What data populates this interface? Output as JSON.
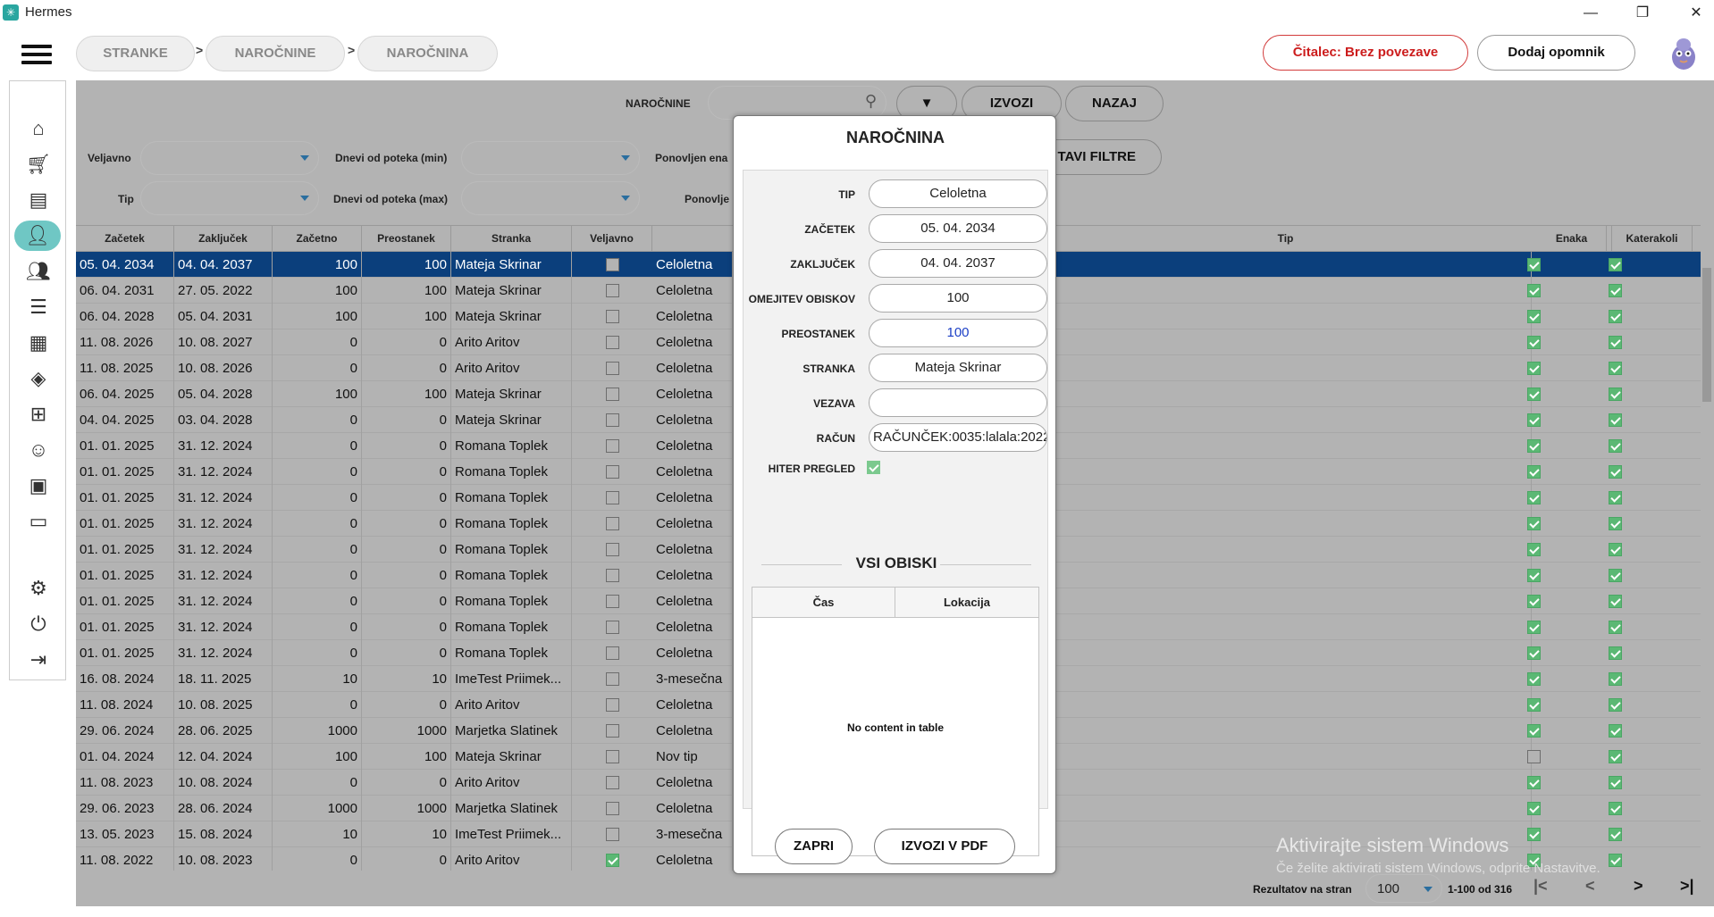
{
  "window": {
    "title": "Hermes",
    "minimize": "—",
    "restore": "❐",
    "close": "✕"
  },
  "breadcrumb": [
    {
      "label": "STRANKE"
    },
    {
      "label": "NAROČNINE"
    },
    {
      "label": "NAROČNINA"
    }
  ],
  "breadcrumb_sep": ">",
  "header": {
    "reader_label": "Čitalec: Brez povezave",
    "reminder_label": "Dodaj opomnik"
  },
  "sidebar": {
    "icons": [
      "home-icon",
      "cart-icon",
      "document-icon",
      "person-icon",
      "group-icon",
      "list-icon",
      "calendar-icon",
      "layers-icon",
      "network-icon",
      "worker-icon",
      "briefcase-icon",
      "chat-icon",
      "gear-icon",
      "power-icon",
      "logout-icon"
    ],
    "active": "person-icon"
  },
  "filters": {
    "search_label": "NAROČNINE",
    "search_value": "",
    "export_label": "IZVOZI",
    "back_label": "NAZAJ",
    "reset_label": "TAVI FILTRE",
    "valid_label": "Veljavno",
    "type_label": "Tip",
    "days_min_label": "Dnevi od poteka (min)",
    "days_max_label": "Dnevi od poteka (max)",
    "repeated_label": "Ponovljen ena",
    "repeated2_label": "Ponovlje"
  },
  "table": {
    "headers": {
      "start": "Začetek",
      "end": "Zaključek",
      "initial": "Začetno",
      "remaining": "Preostanek",
      "client": "Stranka",
      "valid": "Veljavno",
      "type": "Tip",
      "same": "Enaka",
      "any": "Katerakoli"
    },
    "rows": [
      {
        "start": "05. 04. 2034",
        "end": "04. 04. 2037",
        "initial": "100",
        "remaining": "100",
        "client": "Mateja Skrinar",
        "valid": false,
        "type": "Celoletna",
        "same": true,
        "any": true
      },
      {
        "start": "06. 04. 2031",
        "end": "27. 05. 2022",
        "initial": "100",
        "remaining": "100",
        "client": "Mateja Skrinar",
        "valid": false,
        "type": "Celoletna",
        "same": true,
        "any": true
      },
      {
        "start": "06. 04. 2028",
        "end": "05. 04. 2031",
        "initial": "100",
        "remaining": "100",
        "client": "Mateja Skrinar",
        "valid": false,
        "type": "Celoletna",
        "same": true,
        "any": true
      },
      {
        "start": "11. 08. 2026",
        "end": "10. 08. 2027",
        "initial": "0",
        "remaining": "0",
        "client": "Arito Aritov",
        "valid": false,
        "type": "Celoletna",
        "same": true,
        "any": true
      },
      {
        "start": "11. 08. 2025",
        "end": "10. 08. 2026",
        "initial": "0",
        "remaining": "0",
        "client": "Arito Aritov",
        "valid": false,
        "type": "Celoletna",
        "same": true,
        "any": true
      },
      {
        "start": "06. 04. 2025",
        "end": "05. 04. 2028",
        "initial": "100",
        "remaining": "100",
        "client": "Mateja Skrinar",
        "valid": false,
        "type": "Celoletna",
        "same": true,
        "any": true
      },
      {
        "start": "04. 04. 2025",
        "end": "03. 04. 2028",
        "initial": "0",
        "remaining": "0",
        "client": "Mateja Skrinar",
        "valid": false,
        "type": "Celoletna",
        "same": true,
        "any": true
      },
      {
        "start": "01. 01. 2025",
        "end": "31. 12. 2024",
        "initial": "0",
        "remaining": "0",
        "client": "Romana Toplek",
        "valid": false,
        "type": "Celoletna",
        "same": true,
        "any": true
      },
      {
        "start": "01. 01. 2025",
        "end": "31. 12. 2024",
        "initial": "0",
        "remaining": "0",
        "client": "Romana Toplek",
        "valid": false,
        "type": "Celoletna",
        "same": true,
        "any": true
      },
      {
        "start": "01. 01. 2025",
        "end": "31. 12. 2024",
        "initial": "0",
        "remaining": "0",
        "client": "Romana Toplek",
        "valid": false,
        "type": "Celoletna",
        "same": true,
        "any": true
      },
      {
        "start": "01. 01. 2025",
        "end": "31. 12. 2024",
        "initial": "0",
        "remaining": "0",
        "client": "Romana Toplek",
        "valid": false,
        "type": "Celoletna",
        "same": true,
        "any": true
      },
      {
        "start": "01. 01. 2025",
        "end": "31. 12. 2024",
        "initial": "0",
        "remaining": "0",
        "client": "Romana Toplek",
        "valid": false,
        "type": "Celoletna",
        "same": true,
        "any": true
      },
      {
        "start": "01. 01. 2025",
        "end": "31. 12. 2024",
        "initial": "0",
        "remaining": "0",
        "client": "Romana Toplek",
        "valid": false,
        "type": "Celoletna",
        "same": true,
        "any": true
      },
      {
        "start": "01. 01. 2025",
        "end": "31. 12. 2024",
        "initial": "0",
        "remaining": "0",
        "client": "Romana Toplek",
        "valid": false,
        "type": "Celoletna",
        "same": true,
        "any": true
      },
      {
        "start": "01. 01. 2025",
        "end": "31. 12. 2024",
        "initial": "0",
        "remaining": "0",
        "client": "Romana Toplek",
        "valid": false,
        "type": "Celoletna",
        "same": true,
        "any": true
      },
      {
        "start": "01. 01. 2025",
        "end": "31. 12. 2024",
        "initial": "0",
        "remaining": "0",
        "client": "Romana Toplek",
        "valid": false,
        "type": "Celoletna",
        "same": true,
        "any": true
      },
      {
        "start": "16. 08. 2024",
        "end": "18. 11. 2025",
        "initial": "10",
        "remaining": "10",
        "client": "ImeTest Priimek...",
        "valid": false,
        "type": "3-mesečna",
        "same": true,
        "any": true
      },
      {
        "start": "11. 08. 2024",
        "end": "10. 08. 2025",
        "initial": "0",
        "remaining": "0",
        "client": "Arito Aritov",
        "valid": false,
        "type": "Celoletna",
        "same": true,
        "any": true
      },
      {
        "start": "29. 06. 2024",
        "end": "28. 06. 2025",
        "initial": "1000",
        "remaining": "1000",
        "client": "Marjetka Slatinek",
        "valid": false,
        "type": "Celoletna",
        "same": true,
        "any": true
      },
      {
        "start": "01. 04. 2024",
        "end": "12. 04. 2024",
        "initial": "100",
        "remaining": "100",
        "client": "Mateja Skrinar",
        "valid": false,
        "type": "Nov tip",
        "same": false,
        "any": true
      },
      {
        "start": "11. 08. 2023",
        "end": "10. 08. 2024",
        "initial": "0",
        "remaining": "0",
        "client": "Arito Aritov",
        "valid": false,
        "type": "Celoletna",
        "same": true,
        "any": true
      },
      {
        "start": "29. 06. 2023",
        "end": "28. 06. 2024",
        "initial": "1000",
        "remaining": "1000",
        "client": "Marjetka Slatinek",
        "valid": false,
        "type": "Celoletna",
        "same": true,
        "any": true
      },
      {
        "start": "13. 05. 2023",
        "end": "15. 08. 2024",
        "initial": "10",
        "remaining": "10",
        "client": "ImeTest Priimek...",
        "valid": false,
        "type": "3-mesečna",
        "same": true,
        "any": true
      },
      {
        "start": "11. 08. 2022",
        "end": "10. 08. 2023",
        "initial": "0",
        "remaining": "0",
        "client": "Arito Aritov",
        "valid": true,
        "type": "Celoletna",
        "same": true,
        "any": true
      }
    ]
  },
  "footer": {
    "per_page_label": "Rezultatov na stran",
    "per_page_value": "100",
    "range": "1-100 od 316",
    "first": "|<",
    "prev": "<",
    "next": ">",
    "last": ">|"
  },
  "modal": {
    "title": "NAROČNINA",
    "fields": [
      {
        "label": "TIP",
        "value": "Celoletna"
      },
      {
        "label": "ZAČETEK",
        "value": "05. 04. 2034"
      },
      {
        "label": "ZAKLJUČEK",
        "value": "04. 04. 2037"
      },
      {
        "label": "OMEJITEV OBISKOV",
        "value": "100"
      },
      {
        "label": "PREOSTANEK",
        "value": "100"
      },
      {
        "label": "STRANKA",
        "value": "Mateja Skrinar"
      },
      {
        "label": "VEZAVA",
        "value": ""
      },
      {
        "label": "RAČUN",
        "value": "RAČUNČEK:0035:lalala:2022"
      }
    ],
    "quick_review_label": "HITER PREGLED",
    "quick_review_checked": true,
    "visits_title": "VSI OBISKI",
    "visits_headers": {
      "time": "Čas",
      "location": "Lokacija"
    },
    "no_content": "No content in table",
    "close_label": "ZAPRI",
    "export_pdf_label": "IZVOZI V PDF"
  },
  "watermark": {
    "line1": "Aktivirajte sistem Windows",
    "line2": "Če želite aktivirati sistem Windows, odprite Nastavitve."
  }
}
